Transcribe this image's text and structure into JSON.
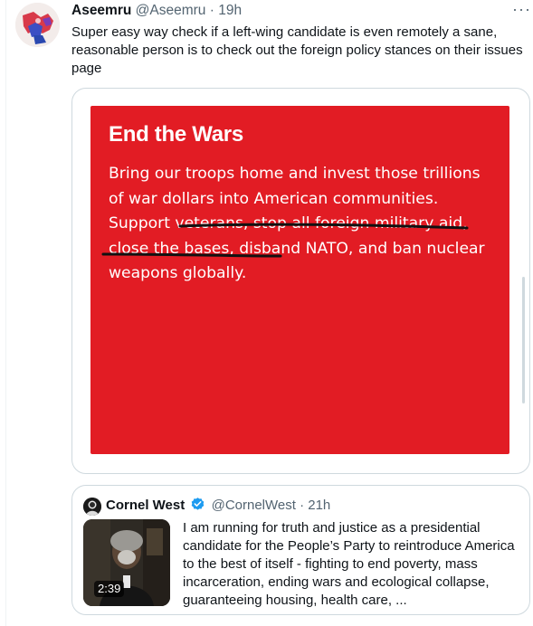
{
  "tweet": {
    "author_name": "Aseemru",
    "author_handle": "@Aseemru",
    "separator": "·",
    "time": "19h",
    "more_label": "···",
    "text": "Super easy way check if a left-wing candidate is even remotely a sane, reasonable person is to check out the foreign policy stances on their issues page"
  },
  "media": {
    "heading": "End the Wars",
    "body_before": "Bring our troops home and invest those trillions of war dollars into American communities. Support veterans, ",
    "body_highlight": "stop all foreign military aid, close the bases, disband NATO,",
    "body_after": " and ban nuclear weapons globally.",
    "background_color": "#e21c24"
  },
  "quote": {
    "author_name": "Cornel West",
    "author_handle": "@CornelWest",
    "separator": "·",
    "time": "21h",
    "video_duration": "2:39",
    "text": "I am running for truth and justice as a presidential candidate for the People’s Party to reintroduce America to the best of itself - fighting to end poverty, mass incarceration, ending wars and ecological collapse, guaranteeing housing, health care, ..."
  },
  "colors": {
    "verified_badge": "#1d9bf0",
    "text_primary": "#0f1419",
    "text_secondary": "#536471",
    "border": "#cfd9de"
  },
  "icons": [
    "avatar-image",
    "more-icon",
    "verified-badge-icon",
    "video-thumbnail"
  ]
}
